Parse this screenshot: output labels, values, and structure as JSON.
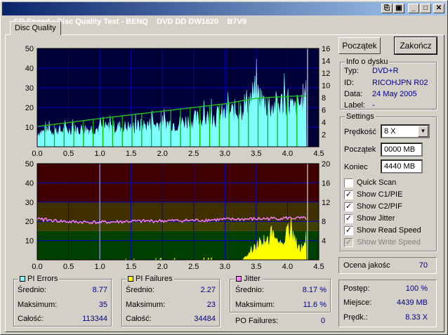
{
  "window": {
    "title": "CD Speed : Disc Quality Test - BENQ    DVD DD DW1620    B7V9",
    "min": "_",
    "max": "□",
    "close": "✕"
  },
  "tab": "Disc Quality",
  "buttons": {
    "start": "Początek",
    "stop": "Zakończ"
  },
  "info": {
    "title": "Info o dysku",
    "type_label": "Typ:",
    "type": "DVD+R",
    "id_label": "ID:",
    "id": "RICOHJPN R02",
    "date_label": "Data:",
    "date": "24 May 2005",
    "label_label": "Label:",
    "label": "-"
  },
  "settings": {
    "title": "Settings",
    "speed_label": "Prędkość",
    "speed": "8 X",
    "start_label": "Początek",
    "start": "0000 MB",
    "end_label": "Koniec",
    "end": "4440 MB",
    "checks": [
      {
        "label": "Quick Scan",
        "checked": false,
        "disabled": false
      },
      {
        "label": "Show C1/PIE",
        "checked": true,
        "disabled": false
      },
      {
        "label": "Show C2/PIF",
        "checked": true,
        "disabled": false
      },
      {
        "label": "Show Jitter",
        "checked": true,
        "disabled": false
      },
      {
        "label": "Show Read Speed",
        "checked": true,
        "disabled": false
      },
      {
        "label": "Show Write Speed",
        "checked": true,
        "disabled": true
      }
    ]
  },
  "score": {
    "label": "Ocena jakośc",
    "value": "70"
  },
  "progress": {
    "progress_label": "Postęp:",
    "progress": "100 %",
    "location_label": "Miejsce:",
    "location": "4439 MB",
    "speed_label": "Prędk.:",
    "speed": "8.33 X"
  },
  "pie": {
    "title": "PI Errors",
    "color": "#80ffff",
    "avg_label": "Średnio:",
    "avg": "8.77",
    "max_label": "Maksimum:",
    "max": "35",
    "total_label": "Całość:",
    "total": "113344"
  },
  "pif": {
    "title": "PI Failures",
    "color": "#ffff00",
    "avg_label": "Średnio:",
    "avg": "2.27",
    "max_label": "Maksimum:",
    "max": "23",
    "total_label": "Całość:",
    "total": "34484"
  },
  "jitter": {
    "title": "Jitter",
    "color": "#ff80ff",
    "avg_label": "Średnio:",
    "avg": "8.17 %",
    "max_label": "Maksimum:",
    "max": "11.6 %"
  },
  "po": {
    "label": "PO Failures:",
    "value": "0"
  },
  "chart_data": [
    {
      "type": "area",
      "name": "top",
      "x_ticks": [
        "0.0",
        "0.5",
        "1.0",
        "1.5",
        "2.0",
        "2.5",
        "3.0",
        "3.5",
        "4.0",
        "4.5"
      ],
      "y_left_ticks": [
        "10",
        "20",
        "30",
        "40",
        "50"
      ],
      "y_right_ticks": [
        "2",
        "4",
        "6",
        "8",
        "10",
        "12",
        "14",
        "16"
      ],
      "ylim_left": [
        0,
        50
      ],
      "ylim_right": [
        0,
        16
      ],
      "xlim": [
        0,
        4.5
      ],
      "series": [
        {
          "name": "PI Errors",
          "x": [
            0,
            0.25,
            0.5,
            0.75,
            1,
            1.25,
            1.5,
            1.75,
            2,
            2.25,
            2.5,
            2.75,
            3,
            3.2,
            3.4,
            3.5,
            3.6,
            3.75,
            3.9,
            4,
            4.1,
            4.2,
            4.3
          ],
          "y": [
            8,
            9,
            9,
            10,
            10,
            11,
            11,
            12,
            13,
            13,
            15,
            16,
            18,
            20,
            26,
            30,
            25,
            22,
            24,
            26,
            20,
            24,
            28
          ]
        },
        {
          "name": "Read Speed",
          "x": [
            0,
            1,
            2,
            3,
            3.5,
            4,
            4.3
          ],
          "y": [
            3.3,
            4.6,
            5.8,
            7.0,
            7.9,
            8.2,
            8.3
          ]
        }
      ]
    },
    {
      "type": "area",
      "name": "bottom",
      "x_ticks": [
        "0.0",
        "0.5",
        "1.0",
        "1.5",
        "2.0",
        "2.5",
        "3.0",
        "3.5",
        "4.0",
        "4.5"
      ],
      "y_left_ticks": [
        "10",
        "20",
        "30",
        "40",
        "50"
      ],
      "y_right_ticks": [
        "4",
        "8",
        "12",
        "16",
        "20"
      ],
      "ylim_left": [
        0,
        50
      ],
      "ylim_right": [
        0,
        20
      ],
      "xlim": [
        0,
        4.5
      ],
      "series": [
        {
          "name": "PI Failures",
          "x": [
            0,
            3.3,
            3.4,
            3.5,
            3.6,
            3.7,
            3.8,
            3.9,
            4,
            4.1,
            4.2,
            4.3
          ],
          "y": [
            0,
            1,
            4,
            8,
            12,
            10,
            14,
            9,
            18,
            12,
            6,
            10
          ]
        },
        {
          "name": "Jitter",
          "x": [
            0,
            0.5,
            1,
            1.5,
            2,
            2.5,
            3,
            3.5,
            4,
            4.3
          ],
          "y": [
            8.5,
            7.9,
            7.8,
            8.0,
            8.1,
            8.2,
            8.4,
            8.5,
            8.7,
            8.6
          ]
        }
      ]
    }
  ]
}
